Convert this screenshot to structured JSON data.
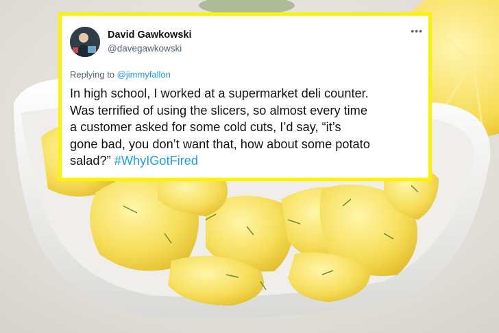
{
  "tweet": {
    "author_name": "David Gawkowski",
    "author_handle": "@davegawkowski",
    "more_icon": "•••",
    "replying_to_prefix": "Replying to ",
    "replying_to_handle": "@jimmyfallon",
    "body_lines": [
      "In high school, I worked at a supermarket deli counter.",
      "Was terrified of using the slicers, so almost every time",
      "a customer asked for some cold cuts, I’d say, “it’s",
      "gone bad, you don’t want that, how about some potato",
      "salad?”"
    ],
    "hashtag": "#WhyIGotFired"
  },
  "colors": {
    "card_border": "#fff200",
    "link": "#1d9bf0",
    "text": "#0f1419",
    "secondary": "#536471"
  },
  "background": {
    "description_icon": "potato-salad-photo"
  }
}
